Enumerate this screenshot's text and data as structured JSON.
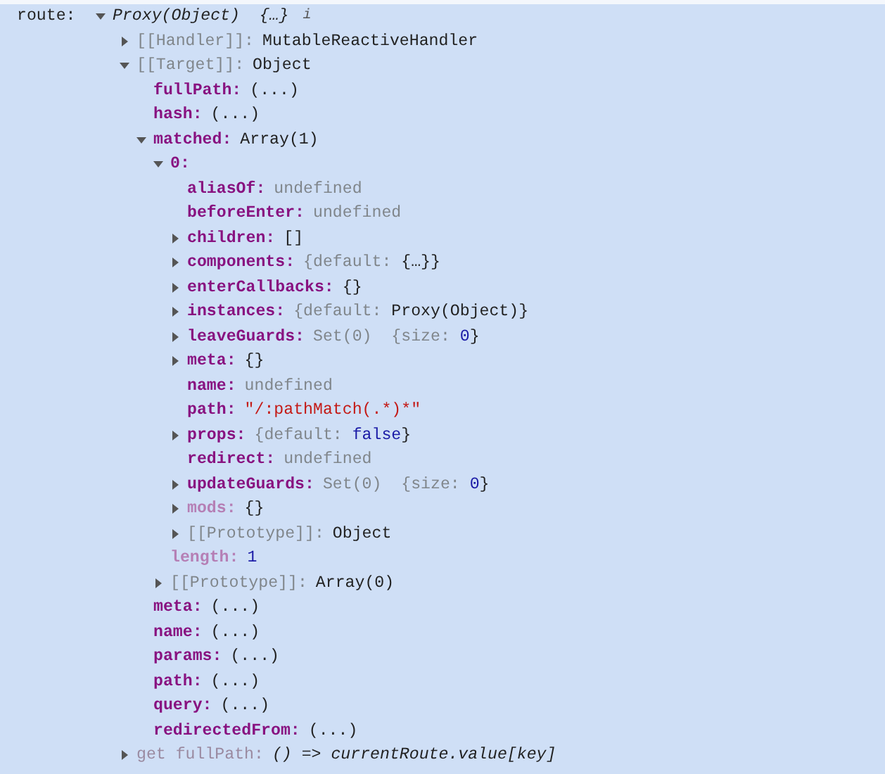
{
  "tree": [
    {
      "key": "route:",
      "kind": "label",
      "expanded": true,
      "value": [
        {
          "text": "Proxy(Object)  {…}",
          "kind": "italic"
        }
      ],
      "badge": "i",
      "children": [
        {
          "key": "[[Handler]]:",
          "kind": "internal",
          "expanded": false,
          "value": [
            {
              "text": "MutableReactiveHandler",
              "kind": "plain"
            }
          ]
        },
        {
          "key": "[[Target]]:",
          "kind": "internal",
          "expanded": true,
          "value": [
            {
              "text": "Object",
              "kind": "plain"
            }
          ],
          "children": [
            {
              "key": "fullPath:",
              "kind": "own",
              "value": [
                {
                  "text": "(...)",
                  "kind": "plain"
                }
              ]
            },
            {
              "key": "hash:",
              "kind": "own",
              "value": [
                {
                  "text": "(...)",
                  "kind": "plain"
                }
              ]
            },
            {
              "key": "matched:",
              "kind": "own",
              "expanded": true,
              "value": [
                {
                  "text": "Array(1)",
                  "kind": "plain"
                }
              ],
              "children": [
                {
                  "key": "0:",
                  "kind": "own",
                  "expanded": true,
                  "children": [
                    {
                      "key": "aliasOf:",
                      "kind": "own",
                      "value": [
                        {
                          "text": "undefined",
                          "kind": "muted"
                        }
                      ]
                    },
                    {
                      "key": "beforeEnter:",
                      "kind": "own",
                      "value": [
                        {
                          "text": "undefined",
                          "kind": "muted"
                        }
                      ]
                    },
                    {
                      "key": "children:",
                      "kind": "own",
                      "expanded": false,
                      "value": [
                        {
                          "text": "[]",
                          "kind": "plain"
                        }
                      ]
                    },
                    {
                      "key": "components:",
                      "kind": "own",
                      "expanded": false,
                      "value": [
                        {
                          "text": "{default: ",
                          "kind": "muted"
                        },
                        {
                          "text": "{…}}",
                          "kind": "plain"
                        }
                      ]
                    },
                    {
                      "key": "enterCallbacks:",
                      "kind": "own",
                      "expanded": false,
                      "value": [
                        {
                          "text": "{}",
                          "kind": "plain"
                        }
                      ]
                    },
                    {
                      "key": "instances:",
                      "kind": "own",
                      "expanded": false,
                      "value": [
                        {
                          "text": "{default: ",
                          "kind": "muted"
                        },
                        {
                          "text": "Proxy(Object)}",
                          "kind": "plain"
                        }
                      ]
                    },
                    {
                      "key": "leaveGuards:",
                      "kind": "own",
                      "expanded": false,
                      "value": [
                        {
                          "text": "Set(0)  {size: ",
                          "kind": "muted"
                        },
                        {
                          "text": "0",
                          "kind": "number"
                        },
                        {
                          "text": "}",
                          "kind": "plain"
                        }
                      ]
                    },
                    {
                      "key": "meta:",
                      "kind": "own",
                      "expanded": false,
                      "value": [
                        {
                          "text": "{}",
                          "kind": "plain"
                        }
                      ]
                    },
                    {
                      "key": "name:",
                      "kind": "own",
                      "value": [
                        {
                          "text": "undefined",
                          "kind": "muted"
                        }
                      ]
                    },
                    {
                      "key": "path:",
                      "kind": "own",
                      "value": [
                        {
                          "text": "\"/:pathMatch(.*)*\"",
                          "kind": "string"
                        }
                      ]
                    },
                    {
                      "key": "props:",
                      "kind": "own",
                      "expanded": false,
                      "value": [
                        {
                          "text": "{default: ",
                          "kind": "muted"
                        },
                        {
                          "text": "false",
                          "kind": "number"
                        },
                        {
                          "text": "}",
                          "kind": "plain"
                        }
                      ]
                    },
                    {
                      "key": "redirect:",
                      "kind": "own",
                      "value": [
                        {
                          "text": "undefined",
                          "kind": "muted"
                        }
                      ]
                    },
                    {
                      "key": "updateGuards:",
                      "kind": "own",
                      "expanded": false,
                      "value": [
                        {
                          "text": "Set(0)  {size: ",
                          "kind": "muted"
                        },
                        {
                          "text": "0",
                          "kind": "number"
                        },
                        {
                          "text": "}",
                          "kind": "plain"
                        }
                      ]
                    },
                    {
                      "key": "mods:",
                      "kind": "dimmed",
                      "expanded": false,
                      "value": [
                        {
                          "text": "{}",
                          "kind": "plain"
                        }
                      ]
                    },
                    {
                      "key": "[[Prototype]]:",
                      "kind": "internal",
                      "expanded": false,
                      "value": [
                        {
                          "text": "Object",
                          "kind": "plain"
                        }
                      ]
                    }
                  ]
                },
                {
                  "key": "length:",
                  "kind": "dimmed",
                  "value": [
                    {
                      "text": "1",
                      "kind": "number"
                    }
                  ]
                },
                {
                  "key": "[[Prototype]]:",
                  "kind": "internal",
                  "expanded": false,
                  "value": [
                    {
                      "text": "Array(0)",
                      "kind": "plain"
                    }
                  ]
                }
              ]
            },
            {
              "key": "meta:",
              "kind": "own",
              "value": [
                {
                  "text": "(...)",
                  "kind": "plain"
                }
              ]
            },
            {
              "key": "name:",
              "kind": "own",
              "value": [
                {
                  "text": "(...)",
                  "kind": "plain"
                }
              ]
            },
            {
              "key": "params:",
              "kind": "own",
              "value": [
                {
                  "text": "(...)",
                  "kind": "plain"
                }
              ]
            },
            {
              "key": "path:",
              "kind": "own",
              "value": [
                {
                  "text": "(...)",
                  "kind": "plain"
                }
              ]
            },
            {
              "key": "query:",
              "kind": "own",
              "value": [
                {
                  "text": "(...)",
                  "kind": "plain"
                }
              ]
            },
            {
              "key": "redirectedFrom:",
              "kind": "own",
              "value": [
                {
                  "text": "(...)",
                  "kind": "plain"
                }
              ]
            }
          ]
        },
        {
          "key": "get fullPath:",
          "kind": "getter",
          "expanded": false,
          "value": [
            {
              "text": "() => currentRoute.value[key]",
              "kind": "italic"
            }
          ]
        }
      ]
    }
  ]
}
